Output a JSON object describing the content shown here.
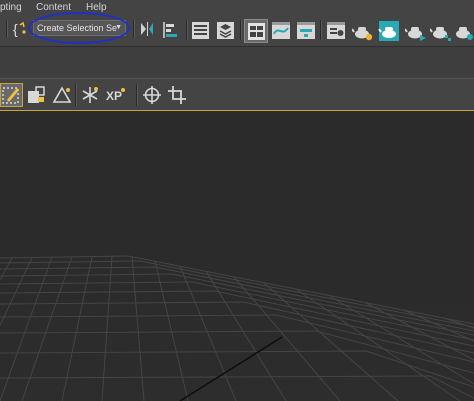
{
  "menu": {
    "items": [
      {
        "label": "pting"
      },
      {
        "label": "Content"
      },
      {
        "label": "Help"
      }
    ]
  },
  "toolbar": {
    "selection_set": {
      "value": "Create Selection Se",
      "arrow": "▼"
    },
    "icons": [
      "curly-brace-icon",
      "mirror-icon",
      "align-icon",
      "layer-manager-icon",
      "scene-explorer-icon",
      "ribbon-toggle-icon",
      "curve-editor-icon",
      "dope-sheet-icon",
      "material-editor-icon",
      "render-setup-icon",
      "rendered-frame-icon",
      "render-teapot-icon",
      "render-production-icon",
      "render-cloud-icon"
    ]
  },
  "toolbar2": {
    "icons": [
      "edit-selection-icon",
      "paint-select-icon",
      "triangle-icon",
      "snowflake-icon",
      "xp-icon",
      "crosshair-icon",
      "crop-icon"
    ]
  },
  "colors": {
    "ui_bg": "#444444",
    "viewport_bg": "#2b2b2b",
    "grid": "#4a4a4a",
    "annotation": "#1f2fc9",
    "accent_teal": "#2aa8b4"
  }
}
